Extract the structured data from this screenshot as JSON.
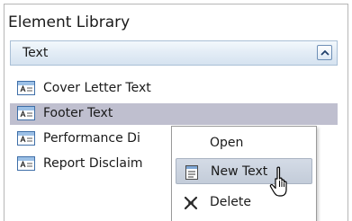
{
  "panel": {
    "title": "Element Library"
  },
  "section": {
    "label": "Text",
    "collapse_icon": "chevron-up-icon"
  },
  "items": [
    {
      "label": "Cover Letter Text",
      "icon": "text-element-icon",
      "selected": false
    },
    {
      "label": "Footer Text",
      "icon": "text-element-icon",
      "selected": true
    },
    {
      "label": "Performance Di",
      "icon": "text-element-icon",
      "selected": false
    },
    {
      "label": "Report Disclaim",
      "icon": "text-element-icon",
      "selected": false
    }
  ],
  "context_menu": {
    "items": [
      {
        "label": "Open",
        "icon": null,
        "hover": false
      },
      {
        "label": "New Text",
        "icon": "new-text-icon",
        "hover": true
      },
      {
        "label": "Delete",
        "icon": "delete-x-icon",
        "hover": false
      }
    ]
  },
  "colors": {
    "selection": "#bfbfcf",
    "header_border": "#a9bfd6"
  }
}
